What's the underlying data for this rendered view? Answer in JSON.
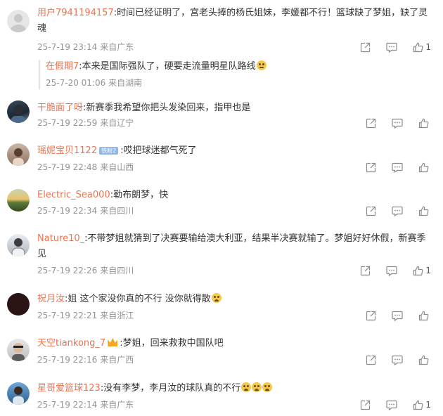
{
  "comments": [
    {
      "user": "用户7941194157",
      "text": ":时间已经证明了，宫老头捧的杨氏姐妹，李媛都不行！篮球缺了梦姐，缺了灵魂",
      "time": "25-7-19 23:14",
      "location": "来自广东",
      "likes": "1",
      "avatar": "default-avatar",
      "reply": {
        "user": "在假期7",
        "text": ":本来是国际强队了，硬要走流量明星队路线",
        "time": "25-7-20 01:06",
        "location": "来自湖南",
        "emoji": "laugh-emoji"
      }
    },
    {
      "user": "干脆面了呀",
      "text": ":新赛季我希望你把头发染回来，指甲也是",
      "time": "25-7-19 22:59",
      "location": "来自辽宁",
      "likes": "",
      "avatar": "photo-avatar"
    },
    {
      "user": "瑶妮宝贝1122",
      "badge": "铁粉2",
      "text": ":哎把球迷都气死了",
      "time": "25-7-19 22:48",
      "location": "来自山西",
      "likes": "",
      "avatar": "photo-avatar"
    },
    {
      "user": "Electric_Sea000",
      "text": ":勒布朗梦，快",
      "time": "25-7-19 22:34",
      "location": "来自四川",
      "likes": "",
      "avatar": "landscape-avatar"
    },
    {
      "user": "Nature10_",
      "text": ":不带梦姐就猜到了决赛要输给澳大利亚，结果半决赛就输了。梦姐好好休假，新赛季见",
      "time": "25-7-19 22:26",
      "location": "来自四川",
      "likes": "1",
      "avatar": "photo-avatar"
    },
    {
      "user": "祝月汝",
      "text": ":姐 这个家没你真的不行 没你就得散",
      "time": "25-7-19 22:21",
      "location": "来自浙江",
      "likes": "",
      "avatar": "dark-avatar",
      "emoji": "cry-emoji"
    },
    {
      "user": "天空tiankong_7",
      "text": ":梦姐，回来救救中国队吧",
      "time": "25-7-19 22:16",
      "location": "来自广西",
      "likes": "",
      "avatar": "photo-avatar",
      "has_crown": true
    },
    {
      "user": "星哥爱篮球123",
      "text": ":没有李梦，李月汝的球队真的不行",
      "time": "25-7-19 22:14",
      "location": "来自广东",
      "likes": "1",
      "avatar": "photo-avatar",
      "emoji": "cry-emoji"
    }
  ],
  "colors": {
    "username": "#eb7350",
    "meta": "#939393",
    "text": "#333333"
  }
}
